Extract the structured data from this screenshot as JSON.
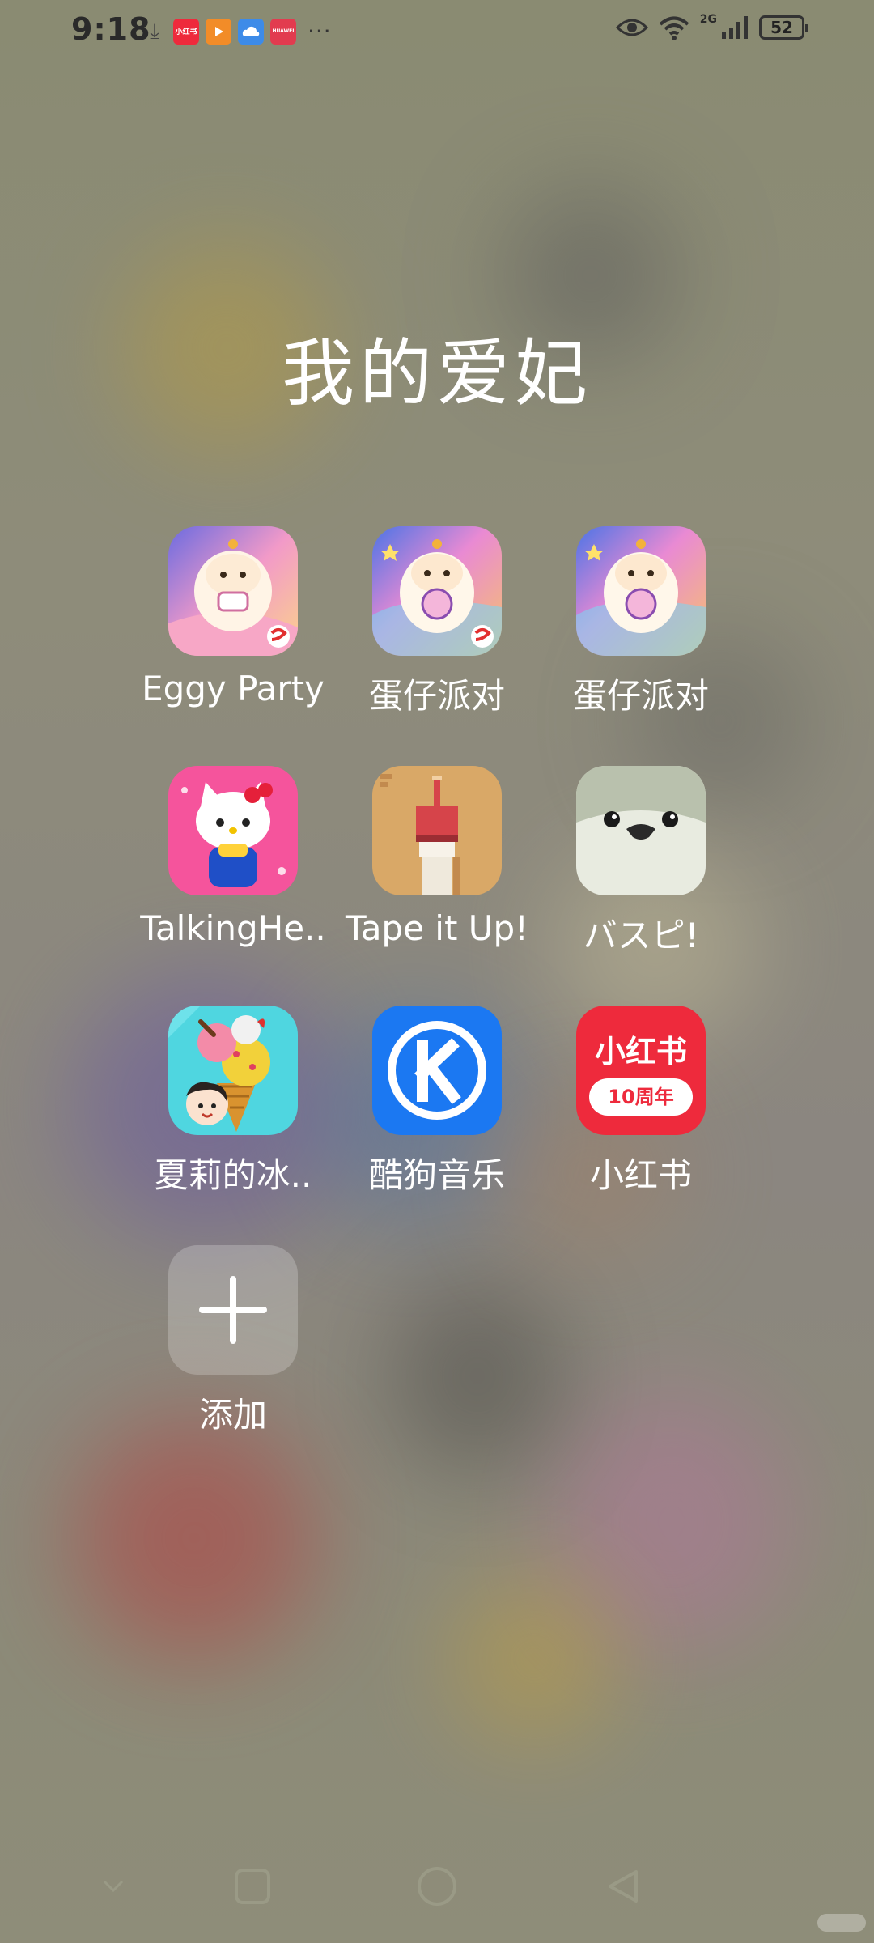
{
  "status_bar": {
    "time": "9:18",
    "notifications": [
      {
        "icon": "download-icon"
      },
      {
        "icon": "xiaohongshu-notification-icon",
        "text": "小红书",
        "color": "#ee2a3c"
      },
      {
        "icon": "video-notification-icon",
        "color": "#f28c28"
      },
      {
        "icon": "cloud-notification-icon",
        "color": "#3d8be8"
      },
      {
        "icon": "huawei-notification-icon",
        "text": "HUAWEI",
        "color": "#e23b4f"
      }
    ],
    "more": "···",
    "network": "2G",
    "battery": "52"
  },
  "folder": {
    "title": "我的爱妃",
    "apps": [
      {
        "label": "Eggy Party",
        "icon": "eggy-party-icon"
      },
      {
        "label": "蛋仔派对",
        "icon": "eggy-party-cn-icon"
      },
      {
        "label": "蛋仔派对",
        "icon": "eggy-party-cn-icon"
      },
      {
        "label": "TalkingHe..",
        "icon": "talking-hello-kitty-icon"
      },
      {
        "label": "Tape it Up!",
        "icon": "tape-it-up-icon"
      },
      {
        "label": "バスピ!",
        "icon": "busupi-icon"
      },
      {
        "label": "夏莉的冰..",
        "icon": "ice-cream-game-icon"
      },
      {
        "label": "酷狗音乐",
        "icon": "kugou-music-icon"
      },
      {
        "label": "小红书",
        "icon": "xiaohongshu-icon"
      }
    ],
    "add_label": "添加",
    "xhs_logo_text": "小红书",
    "xhs_badge_text": "10周年"
  },
  "colors": {
    "kugou_blue": "#1b78f2",
    "xhs_red": "#ee2a3c",
    "hello_kitty_pink": "#f5549c",
    "tape_bg": "#d9a867",
    "busupi_gray": "#b9c1ad"
  }
}
